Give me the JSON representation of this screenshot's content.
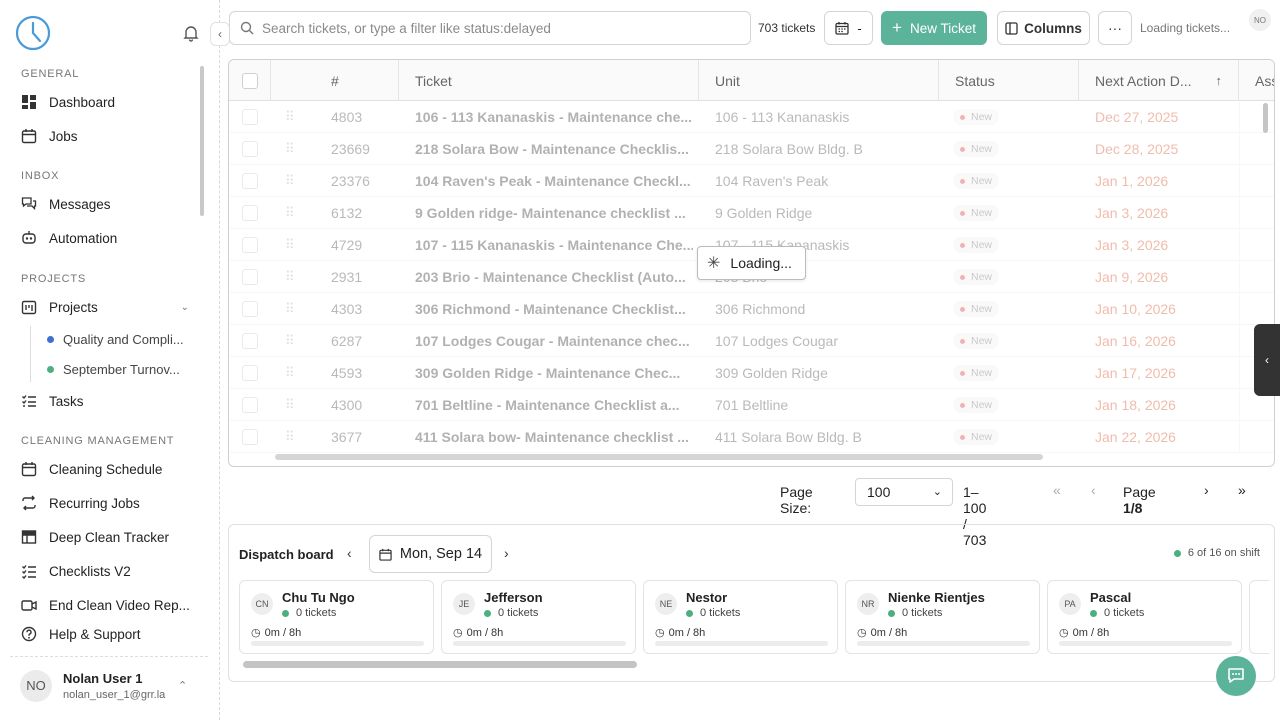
{
  "sidebar": {
    "sections": {
      "general": "GENERAL",
      "inbox": "INBOX",
      "projects": "PROJECTS",
      "cleaning": "CLEANING MANAGEMENT"
    },
    "items": {
      "dashboard": "Dashboard",
      "jobs": "Jobs",
      "messages": "Messages",
      "automation": "Automation",
      "projects": "Projects",
      "tasks": "Tasks",
      "cleaning_schedule": "Cleaning Schedule",
      "recurring_jobs": "Recurring Jobs",
      "deep_clean_tracker": "Deep Clean Tracker",
      "checklists_v2": "Checklists V2",
      "end_clean_video": "End Clean Video Rep...",
      "help": "Help & Support"
    },
    "subprojects": [
      {
        "label": "Quality and Compli...",
        "color": "#3f6fd1"
      },
      {
        "label": "September Turnov...",
        "color": "#4caf7d"
      }
    ],
    "user": {
      "initials": "NO",
      "name": "Nolan User 1",
      "email": "nolan_user_1@grr.la"
    }
  },
  "toolbar": {
    "search_placeholder": "Search tickets, or type a filter like status:delayed",
    "ticket_count": "703 tickets",
    "date_label": "-",
    "new_ticket": "New Ticket",
    "columns": "Columns",
    "more": "···",
    "loading": "Loading tickets...",
    "avatar": "NO"
  },
  "grid": {
    "headers": {
      "num": "#",
      "ticket": "Ticket",
      "unit": "Unit",
      "status": "Status",
      "next_action": "Next Action D...",
      "assignee": "Ass"
    },
    "rows": [
      {
        "num": "4803",
        "ticket": "106 - 113 Kananaskis - Maintenance che...",
        "unit": "106 - 113 Kananaskis",
        "status": "New",
        "date": "Dec 27, 2025"
      },
      {
        "num": "23669",
        "ticket": "218 Solara Bow - Maintenance Checklis...",
        "unit": "218 Solara Bow Bldg. B",
        "status": "New",
        "date": "Dec 28, 2025"
      },
      {
        "num": "23376",
        "ticket": "104 Raven's Peak - Maintenance Checkl...",
        "unit": "104 Raven's Peak",
        "status": "New",
        "date": "Jan 1, 2026"
      },
      {
        "num": "6132",
        "ticket": "9 Golden ridge- Maintenance checklist ...",
        "unit": "9 Golden Ridge",
        "status": "New",
        "date": "Jan 3, 2026"
      },
      {
        "num": "4729",
        "ticket": "107 - 115 Kananaskis - Maintenance Che...",
        "unit": "107 - 115 Kananaskis",
        "status": "New",
        "date": "Jan 3, 2026"
      },
      {
        "num": "2931",
        "ticket": "203 Brio - Maintenance Checklist (Auto...",
        "unit": "203 Brio",
        "status": "New",
        "date": "Jan 9, 2026"
      },
      {
        "num": "4303",
        "ticket": "306 Richmond - Maintenance Checklist...",
        "unit": "306 Richmond",
        "status": "New",
        "date": "Jan 10, 2026"
      },
      {
        "num": "6287",
        "ticket": "107 Lodges Cougar - Maintenance chec...",
        "unit": "107 Lodges Cougar",
        "status": "New",
        "date": "Jan 16, 2026"
      },
      {
        "num": "4593",
        "ticket": "309 Golden Ridge - Maintenance Chec...",
        "unit": "309 Golden Ridge",
        "status": "New",
        "date": "Jan 17, 2026"
      },
      {
        "num": "4300",
        "ticket": "701 Beltline - Maintenance Checklist a...",
        "unit": "701 Beltline",
        "status": "New",
        "date": "Jan 18, 2026"
      },
      {
        "num": "3677",
        "ticket": "411 Solara bow- Maintenance checklist ...",
        "unit": "411 Solara Bow Bldg. B",
        "status": "New",
        "date": "Jan 22, 2026"
      }
    ],
    "loading": "Loading..."
  },
  "pager": {
    "size_label": "Page Size:",
    "size_value": "100",
    "range": "1–100 / 703",
    "page_prefix": "Page ",
    "page_current": "1/8"
  },
  "dispatch": {
    "title": "Dispatch board",
    "date": "Mon, Sep 14",
    "on_shift": "6 of 16 on shift",
    "workers": [
      {
        "initials": "CN",
        "name": "Chu Tu Ngo",
        "tickets": "0 tickets",
        "hours": "0m / 8h"
      },
      {
        "initials": "JE",
        "name": "Jefferson",
        "tickets": "0 tickets",
        "hours": "0m / 8h"
      },
      {
        "initials": "NE",
        "name": "Nestor",
        "tickets": "0 tickets",
        "hours": "0m / 8h"
      },
      {
        "initials": "NR",
        "name": "Nienke Rientjes",
        "tickets": "0 tickets",
        "hours": "0m / 8h"
      },
      {
        "initials": "PA",
        "name": "Pascal",
        "tickets": "0 tickets",
        "hours": "0m / 8h"
      }
    ]
  },
  "colors": {
    "accent": "#5bb39a",
    "due": "#e06b4b",
    "on_shift": "#4caf7d"
  }
}
